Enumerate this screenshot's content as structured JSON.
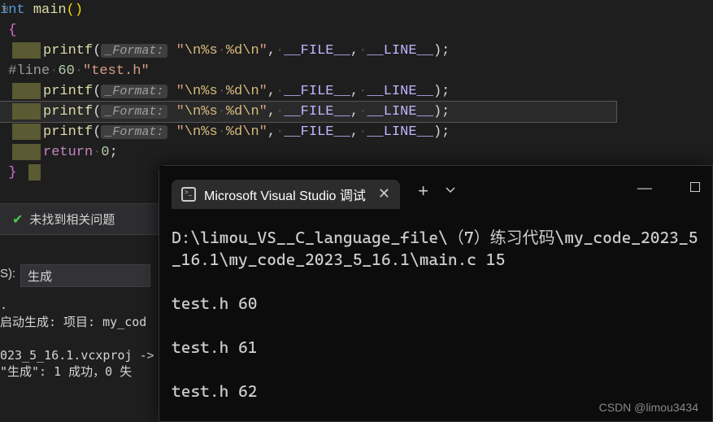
{
  "code": {
    "sig_type": "int",
    "sig_name": "main",
    "open_brace": "{",
    "printf": "printf",
    "fmt_hint": "_Format:",
    "string_open": "\"",
    "esc1": "\\n",
    "fmt_s": "%s",
    "space": " ",
    "fmt_d": "%d",
    "esc2": "\\n",
    "string_close": "\"",
    "comma": ",",
    "macro_file": "__FILE__",
    "macro_line": "__LINE__",
    "semi": ";",
    "line_directive_pre": "#line",
    "line_directive_num": "60",
    "line_directive_file": "\"test.h\"",
    "return_kw": "return",
    "return_val": "0",
    "close_brace": "}"
  },
  "status": {
    "no_issues": "未找到相关问题"
  },
  "output": {
    "label_suffix": "S):",
    "dropdown_value": "生成",
    "line1": "启动生成: 项目: my_cod",
    "line2": "",
    "line3": "023_5_16.1.vcxproj -> ",
    "line4": "\"生成\": 1 成功，0 失"
  },
  "terminal": {
    "tab_title": "Microsoft Visual Studio 调试",
    "path_line1": "D:\\limou_VS__C_language_file\\（7）练习代码\\my_code_2023_5_16.1\\my_code_2023_5_16.1\\main.c 15",
    "out1": "test.h 60",
    "out2": "test.h 61",
    "out3": "test.h 62"
  },
  "watermark": "CSDN @limou3434"
}
